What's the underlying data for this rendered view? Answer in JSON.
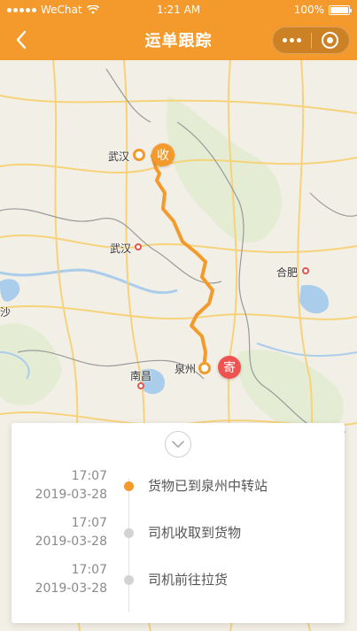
{
  "status_bar": {
    "carrier": "WeChat",
    "time": "1:21 AM",
    "battery": "100%",
    "battery_level": 1.0
  },
  "nav": {
    "title": "运单跟踪"
  },
  "colors": {
    "accent": "#f49a2c",
    "sender_badge": "#ef5350",
    "route": "#f49a2c"
  },
  "icons": {
    "back": "chevron-left-icon",
    "more": "more-dots-icon",
    "close": "target-circle-icon",
    "collapse": "chevron-down-icon"
  },
  "map": {
    "cities": [
      {
        "name": "武汉",
        "id": "destination-wuhan"
      },
      {
        "name": "武汉",
        "id": "wuhan"
      },
      {
        "name": "合肥",
        "id": "hefei"
      },
      {
        "name": "南昌",
        "id": "nanchang"
      },
      {
        "name": "泉州",
        "id": "origin-quanzhou"
      },
      {
        "name": "沙",
        "id": "sha-partial"
      }
    ],
    "receive_badge": "收",
    "send_badge": "寄"
  },
  "timeline": [
    {
      "time": "17:07",
      "date": "2019-03-28",
      "text": "货物已到泉州中转站",
      "active": true
    },
    {
      "time": "17:07",
      "date": "2019-03-28",
      "text": "司机收取到货物",
      "active": false
    },
    {
      "time": "17:07",
      "date": "2019-03-28",
      "text": "司机前往拉货",
      "active": false
    }
  ]
}
